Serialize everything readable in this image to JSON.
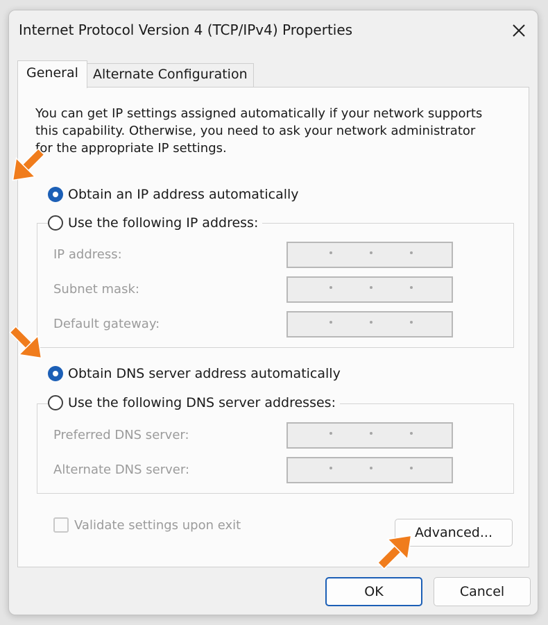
{
  "window": {
    "title": "Internet Protocol Version 4 (TCP/IPv4) Properties",
    "close_icon": "close-icon"
  },
  "tabs": [
    {
      "label": "General",
      "active": true
    },
    {
      "label": "Alternate Configuration",
      "active": false
    }
  ],
  "description": [
    "You can get IP settings assigned automatically if your network supports",
    "this capability. Otherwise, you need to ask your network administrator",
    "for the appropriate IP settings."
  ],
  "ip_section": {
    "auto_label": "Obtain an IP address automatically",
    "auto_selected": true,
    "manual_label": "Use the following IP address:",
    "manual_selected": false,
    "fields": [
      {
        "label": "IP address:",
        "value": ". . ."
      },
      {
        "label": "Subnet mask:",
        "value": ". . ."
      },
      {
        "label": "Default gateway:",
        "value": ". . ."
      }
    ]
  },
  "dns_section": {
    "auto_label": "Obtain DNS server address automatically",
    "auto_selected": true,
    "manual_label": "Use the following DNS server addresses:",
    "manual_selected": false,
    "fields": [
      {
        "label": "Preferred DNS server:",
        "value": ". . ."
      },
      {
        "label": "Alternate DNS server:",
        "value": ". . ."
      }
    ]
  },
  "validate": {
    "label": "Validate settings upon exit",
    "checked": false,
    "enabled": false
  },
  "buttons": {
    "advanced": "Advanced...",
    "ok": "OK",
    "cancel": "Cancel"
  },
  "colors": {
    "accent": "#1c5fb6",
    "annotation_arrow": "#f07c1c",
    "disabled_text": "#9b9b9b"
  }
}
